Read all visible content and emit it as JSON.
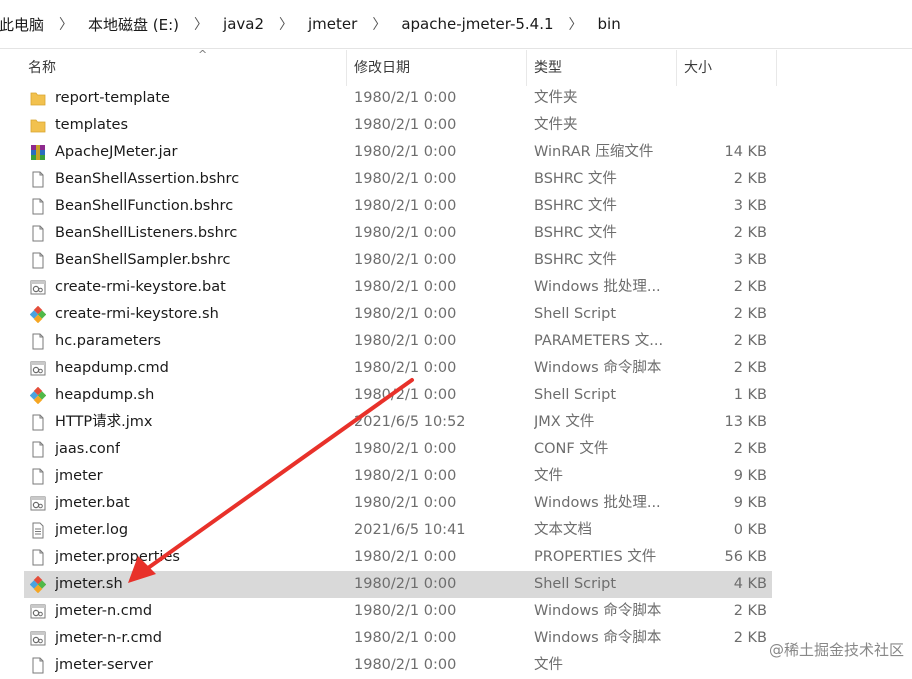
{
  "breadcrumb": [
    "此电脑",
    "本地磁盘 (E:)",
    "java2",
    "jmeter",
    "apache-jmeter-5.4.1",
    "bin"
  ],
  "columns": {
    "name": "名称",
    "date": "修改日期",
    "type": "类型",
    "size": "大小"
  },
  "files": [
    {
      "name": "report-template",
      "date": "1980/2/1 0:00",
      "type": "文件夹",
      "size": "",
      "icon": "folder-icon"
    },
    {
      "name": "templates",
      "date": "1980/2/1 0:00",
      "type": "文件夹",
      "size": "",
      "icon": "folder-icon"
    },
    {
      "name": "ApacheJMeter.jar",
      "date": "1980/2/1 0:00",
      "type": "WinRAR 压缩文件",
      "size": "14 KB",
      "icon": "winrar-icon"
    },
    {
      "name": "BeanShellAssertion.bshrc",
      "date": "1980/2/1 0:00",
      "type": "BSHRC 文件",
      "size": "2 KB",
      "icon": "file-icon"
    },
    {
      "name": "BeanShellFunction.bshrc",
      "date": "1980/2/1 0:00",
      "type": "BSHRC 文件",
      "size": "3 KB",
      "icon": "file-icon"
    },
    {
      "name": "BeanShellListeners.bshrc",
      "date": "1980/2/1 0:00",
      "type": "BSHRC 文件",
      "size": "2 KB",
      "icon": "file-icon"
    },
    {
      "name": "BeanShellSampler.bshrc",
      "date": "1980/2/1 0:00",
      "type": "BSHRC 文件",
      "size": "3 KB",
      "icon": "file-icon"
    },
    {
      "name": "create-rmi-keystore.bat",
      "date": "1980/2/1 0:00",
      "type": "Windows 批处理...",
      "size": "2 KB",
      "icon": "batch-icon"
    },
    {
      "name": "create-rmi-keystore.sh",
      "date": "1980/2/1 0:00",
      "type": "Shell Script",
      "size": "2 KB",
      "icon": "shell-script-icon"
    },
    {
      "name": "hc.parameters",
      "date": "1980/2/1 0:00",
      "type": "PARAMETERS 文...",
      "size": "2 KB",
      "icon": "file-icon"
    },
    {
      "name": "heapdump.cmd",
      "date": "1980/2/1 0:00",
      "type": "Windows 命令脚本",
      "size": "2 KB",
      "icon": "batch-icon"
    },
    {
      "name": "heapdump.sh",
      "date": "1980/2/1 0:00",
      "type": "Shell Script",
      "size": "1 KB",
      "icon": "shell-script-icon"
    },
    {
      "name": "HTTP请求.jmx",
      "date": "2021/6/5 10:52",
      "type": "JMX 文件",
      "size": "13 KB",
      "icon": "file-icon"
    },
    {
      "name": "jaas.conf",
      "date": "1980/2/1 0:00",
      "type": "CONF 文件",
      "size": "2 KB",
      "icon": "file-icon"
    },
    {
      "name": "jmeter",
      "date": "1980/2/1 0:00",
      "type": "文件",
      "size": "9 KB",
      "icon": "file-icon"
    },
    {
      "name": "jmeter.bat",
      "date": "1980/2/1 0:00",
      "type": "Windows 批处理...",
      "size": "9 KB",
      "icon": "batch-icon"
    },
    {
      "name": "jmeter.log",
      "date": "2021/6/5 10:41",
      "type": "文本文档",
      "size": "0 KB",
      "icon": "text-file-icon"
    },
    {
      "name": "jmeter.properties",
      "date": "1980/2/1 0:00",
      "type": "PROPERTIES 文件",
      "size": "56 KB",
      "icon": "file-icon"
    },
    {
      "name": "jmeter.sh",
      "date": "1980/2/1 0:00",
      "type": "Shell Script",
      "size": "4 KB",
      "icon": "shell-script-icon",
      "selected": true
    },
    {
      "name": "jmeter-n.cmd",
      "date": "1980/2/1 0:00",
      "type": "Windows 命令脚本",
      "size": "2 KB",
      "icon": "batch-icon"
    },
    {
      "name": "jmeter-n-r.cmd",
      "date": "1980/2/1 0:00",
      "type": "Windows 命令脚本",
      "size": "2 KB",
      "icon": "batch-icon"
    },
    {
      "name": "jmeter-server",
      "date": "1980/2/1 0:00",
      "type": "文件",
      "size": "",
      "icon": "file-icon"
    }
  ],
  "colors": {
    "selected_row": "#d9d9d9",
    "arrow": "#e8312a",
    "folder": "#f2c14e"
  },
  "watermark": "@稀土掘金技术社区"
}
